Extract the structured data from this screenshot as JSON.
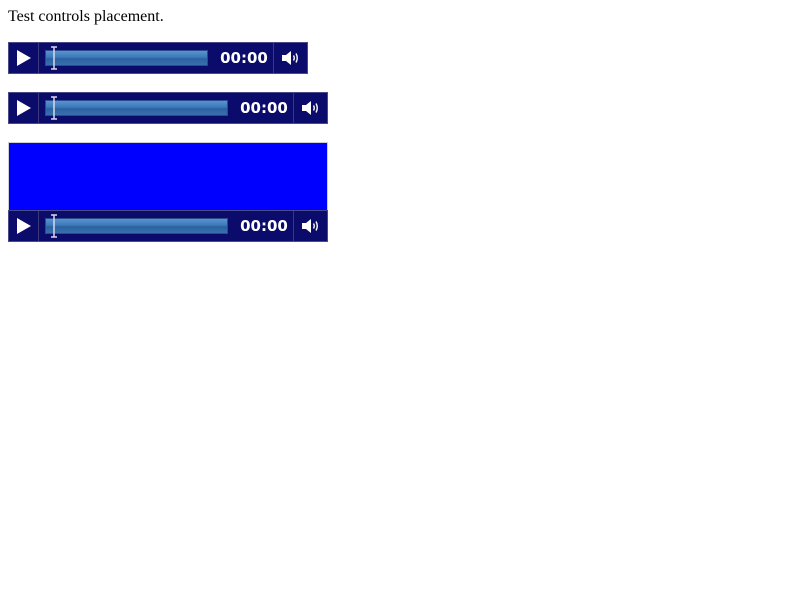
{
  "page": {
    "heading": "Test controls placement."
  },
  "players": [
    {
      "time": "00:00",
      "progress": 0
    },
    {
      "time": "00:00",
      "progress": 0
    },
    {
      "time": "00:00",
      "progress": 0
    }
  ],
  "icons": {
    "play": "play-icon",
    "volume": "speaker-volume-icon",
    "scrubber": "timeline-thumb-icon"
  },
  "colors": {
    "controls_background": "#0b0b6b",
    "timeline": "#3c78b8",
    "video_background": "#0000ff",
    "text": "#ffffff"
  }
}
